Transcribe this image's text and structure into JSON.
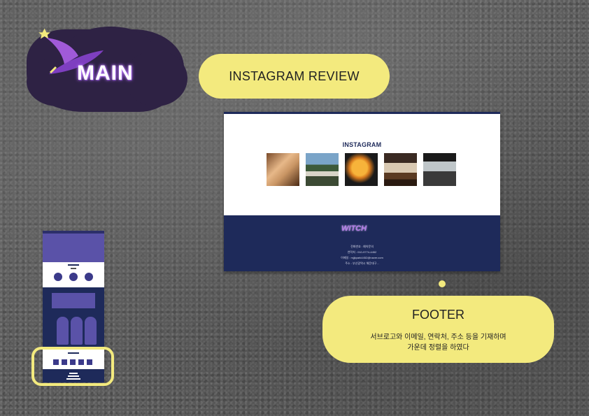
{
  "title": "MAIN",
  "labels": {
    "instagram_review": "INSTAGRAM REVIEW",
    "footer": "FOOTER",
    "footer_desc_line1": "서브로고와 이메일, 연락처, 주소 등을 기재하며",
    "footer_desc_line2": "가운데 정렬을 하였다"
  },
  "screenshot": {
    "section_title": "INSTAGRAM",
    "footer_logo": "WITCH",
    "footer_lines": [
      "전화번호 : 예약문의",
      "연락처 : 010-9774-4452",
      "이메일 : mjjkpark4452@naver.com",
      "주소 : 부산광역시 해운대구..."
    ]
  },
  "colors": {
    "accent_yellow": "#f3ea7e",
    "navy": "#1e2a5a",
    "purple": "#5a52a8",
    "blob": "#2e2244"
  }
}
